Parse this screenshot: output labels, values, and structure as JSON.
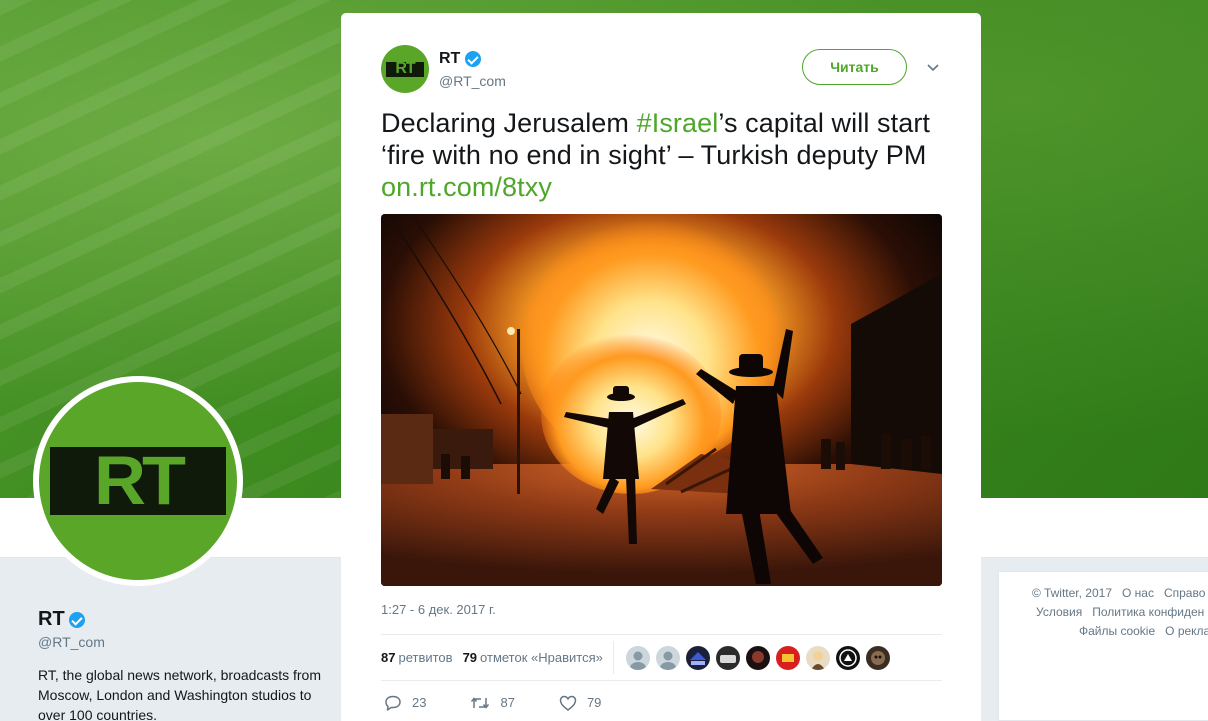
{
  "profile": {
    "name": "RT",
    "handle": "@RT_com",
    "bio": "RT, the global news network, broadcasts from Moscow, London and Washington studios to over 100 countries.",
    "avatar_logo": "RT"
  },
  "footer": {
    "row1": [
      "© Twitter, 2017",
      "О нас",
      "Справо"
    ],
    "row2": [
      "Условия",
      "Политика конфиден"
    ],
    "row3": [
      "Файлы cookie",
      "О рекла"
    ]
  },
  "tweet": {
    "author_name": "RT",
    "author_handle": "@RT_com",
    "avatar_logo": "RT",
    "follow_label": "Читать",
    "text_part1": "Declaring Jerusalem ",
    "hashtag": "#Israel",
    "text_part2": "’s capital will start ‘fire with no end in sight’ – Turkish deputy PM",
    "link": "on.rt.com/8txy",
    "timestamp": "1:27 - 6 дек. 2017 г.",
    "retweets_count": "87",
    "retweets_label": "ретвитов",
    "likes_count": "79",
    "likes_label": "отметок «Нравится»",
    "replies": "23",
    "retweets": "87",
    "likes": "79"
  },
  "icons": {
    "verified": "verified-badge-icon",
    "caret": "chevron-down-icon",
    "reply": "reply-icon",
    "retweet": "retweet-icon",
    "like": "heart-icon"
  },
  "colors": {
    "accent": "#4ea72a",
    "rt_green": "#5aa628",
    "verified": "#1da1f2",
    "muted": "#657786"
  }
}
